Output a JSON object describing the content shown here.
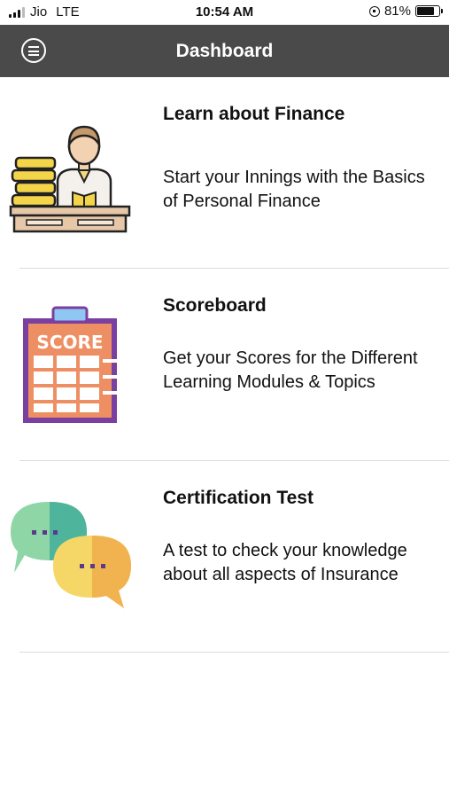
{
  "status_bar": {
    "carrier": "Jio",
    "network": "LTE",
    "time": "10:54 AM",
    "battery": "81%",
    "battery_level": 0.81
  },
  "header": {
    "title": "Dashboard",
    "menu_icon": "menu-icon"
  },
  "cards": [
    {
      "title": "Learn about Finance",
      "description": "Start your Innings with the Basics of Personal Finance",
      "icon": "student-with-books-icon"
    },
    {
      "title": "Scoreboard",
      "description": "Get your Scores for the Different Learning Modules & Topics",
      "icon": "score-clipboard-icon",
      "icon_text": "SCORE"
    },
    {
      "title": "Certification Test",
      "description": "A test to check your knowledge about all aspects of Insurance",
      "icon": "chat-bubbles-icon"
    }
  ],
  "colors": {
    "app_bar": "#4a4a4a",
    "divider": "#dcdcdc"
  }
}
